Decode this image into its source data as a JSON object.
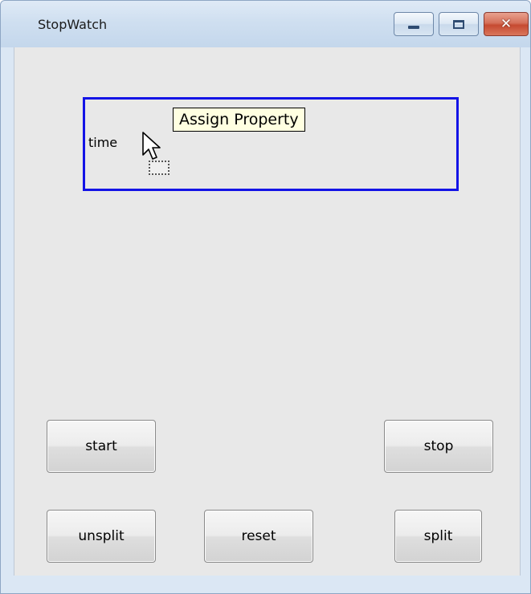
{
  "window": {
    "title": "StopWatch",
    "controls": {
      "minimize_icon": "minimize-icon",
      "maximize_icon": "maximize-icon",
      "close_icon": "close-icon",
      "close_glyph": "✕"
    }
  },
  "panel": {
    "time_label": "time",
    "tooltip": "Assign Property",
    "border_color": "#1313e6"
  },
  "buttons": {
    "start": "start",
    "stop": "stop",
    "unsplit": "unsplit",
    "reset": "reset",
    "split": "split"
  },
  "colors": {
    "client_bg": "#e8e8e8",
    "tooltip_bg": "#ffffe1",
    "close_button": "#c64a31"
  }
}
